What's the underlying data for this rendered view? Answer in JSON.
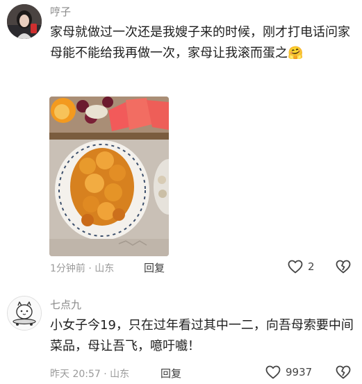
{
  "comments": [
    {
      "username": "哼子",
      "text": "家母就做过一次还是我嫂子来的时候，刚才打电话问家母能不能给我再做一次，家母让我滚而蛋之",
      "emoji": "🤗",
      "time": "1分钟前",
      "location": "山东",
      "reply_label": "回复",
      "like_count": "2"
    },
    {
      "username": "七点九",
      "text": "小女子今19，只在过年看过其中一二，向吾母索要中间菜品，母让吾飞，噫吁嚱！",
      "time": "昨天 20:57",
      "location": "山东",
      "reply_label": "回复",
      "like_count": "9937"
    }
  ],
  "icons": {
    "like": "heart-outline-icon",
    "dislike": "broken-heart-icon"
  }
}
